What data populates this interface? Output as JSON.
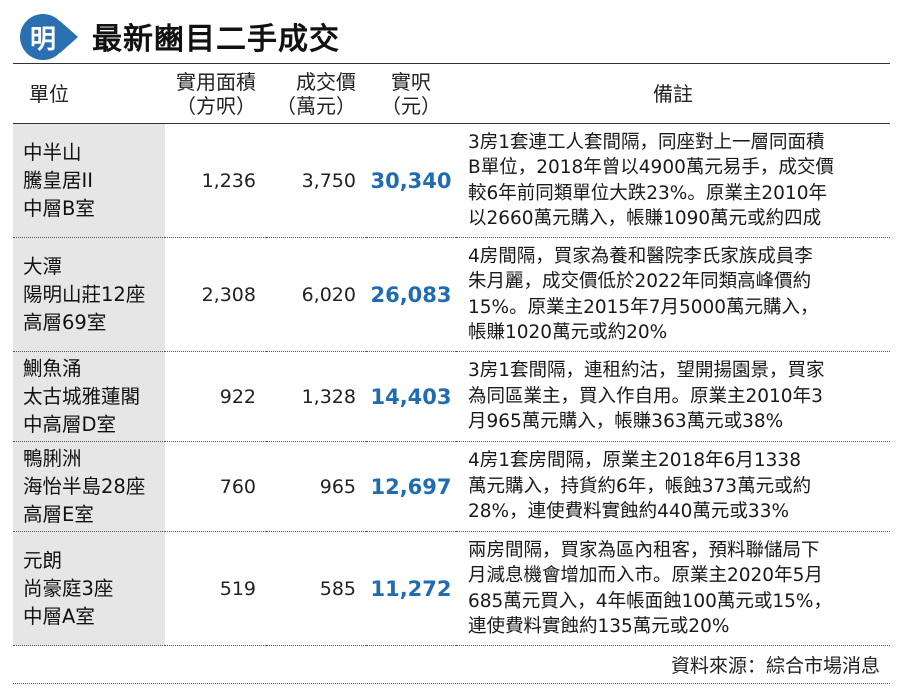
{
  "header": {
    "logo_text": "明",
    "title": "最新豳目二手成交"
  },
  "columns": {
    "unit": "單位",
    "area": [
      "實用面積",
      "（方呎）"
    ],
    "price": [
      "成交價",
      "（萬元）"
    ],
    "psf": [
      "實呎",
      "（元）"
    ],
    "note": "備註"
  },
  "rows": [
    {
      "unit": [
        "中半山",
        "騰皇居II",
        "中層B室"
      ],
      "area": "1,236",
      "price": "3,750",
      "psf": "30,340",
      "note": [
        "3房1套連工人套間隔，同座對上一層同面積",
        "B單位，2018年曾以4900萬元易手，成交價",
        "較6年前同類單位大跌23%。原業主2010年",
        "以2660萬元購入，帳賺1090萬元或約四成"
      ]
    },
    {
      "unit": [
        "大潭",
        "陽明山莊12座",
        "高層69室"
      ],
      "area": "2,308",
      "price": "6,020",
      "psf": "26,083",
      "note": [
        "4房間隔，買家為養和醫院李氏家族成員李",
        "朱月麗，成交價低於2022年同類高峰價約",
        "15%。原業主2015年7月5000萬元購入，",
        "帳賺1020萬元或約20%"
      ]
    },
    {
      "unit": [
        "鰂魚涌",
        "太古城雅蓮閣",
        "中高層D室"
      ],
      "area": "922",
      "price": "1,328",
      "psf": "14,403",
      "note": [
        "3房1套間隔，連租約沽，望開揚園景，買家",
        "為同區業主，買入作自用。原業主2010年3",
        "月965萬元購入，帳賺363萬元或38%"
      ]
    },
    {
      "unit": [
        "鴨脷洲",
        "海怡半島28座",
        "高層E室"
      ],
      "area": "760",
      "price": "965",
      "psf": "12,697",
      "note": [
        "4房1套房間隔，原業主2018年6月1338",
        "萬元購入，持貨約6年，帳蝕373萬元或約",
        "28%，連使費料實蝕約440萬元或33%"
      ]
    },
    {
      "unit": [
        "元朗",
        "尚豪庭3座",
        "中層A室"
      ],
      "area": "519",
      "price": "585",
      "psf": "11,272",
      "note": [
        "兩房間隔，買家為區內租客，預料聯儲局下",
        "月減息機會增加而入市。原業主2020年5月",
        "685萬元買入，4年帳面蝕100萬元或15%，",
        "連使費料實蝕約135萬元或20%"
      ]
    }
  ],
  "source": "資料來源：綜合市場消息",
  "colors": {
    "accent": "#1f6cb3",
    "logo": "#2a6fb0",
    "unit_bg": "#e6e6e6"
  }
}
